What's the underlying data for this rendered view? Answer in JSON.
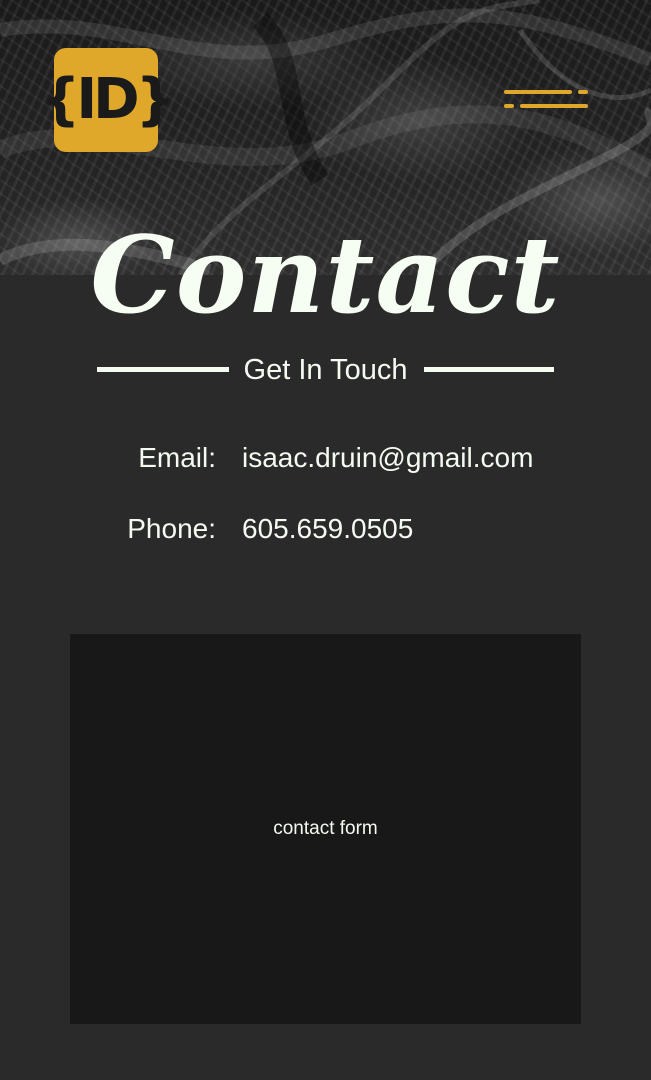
{
  "header": {
    "logo_text": "{ID}",
    "logo_color": "#e0a82a",
    "menu_icon": "hamburger-menu-icon"
  },
  "page": {
    "title": "Contact",
    "subtitle": "Get In Touch"
  },
  "contact": {
    "email_label": "Email:",
    "email_value": "isaac.druin@gmail.com",
    "phone_label": "Phone:",
    "phone_value": "605.659.0505"
  },
  "form": {
    "placeholder_label": "contact form"
  },
  "colors": {
    "accent": "#e0a82a",
    "background": "#2a2a2a",
    "form_background": "#181818",
    "text": "#f4fbf1"
  }
}
